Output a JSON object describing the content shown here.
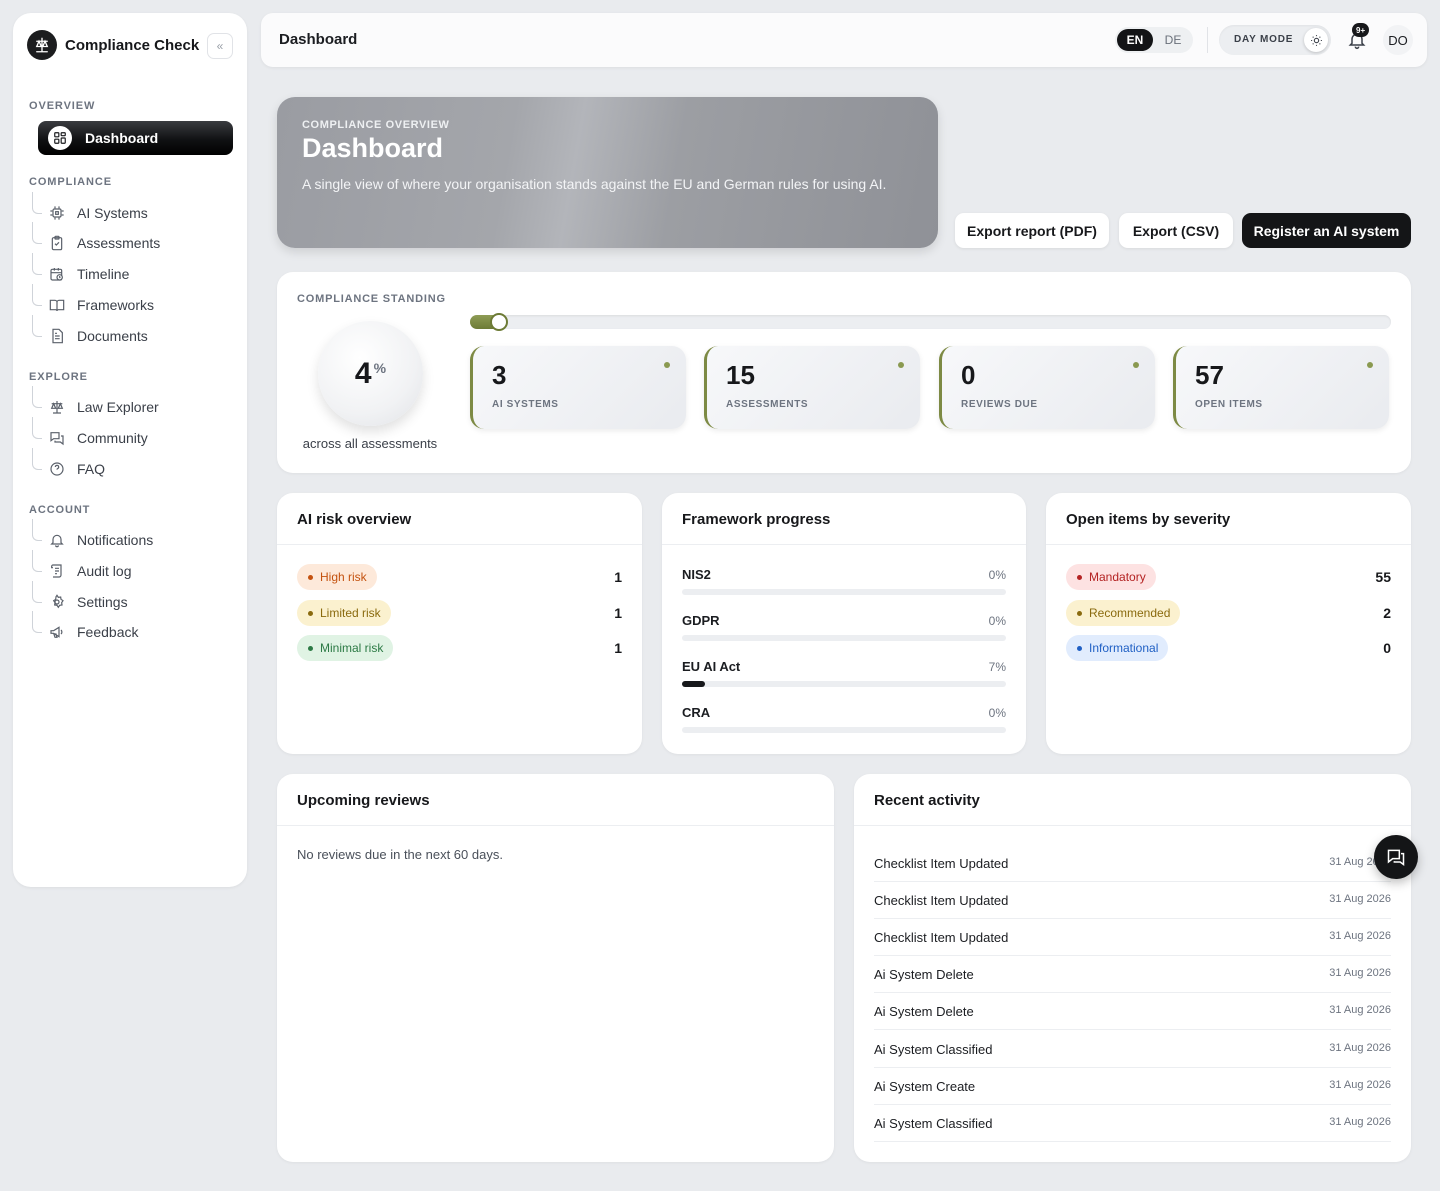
{
  "sidebar": {
    "brand": "Compliance Check",
    "collapse_icon": "«",
    "sections": {
      "overview": "OVERVIEW",
      "compliance": "COMPLIANCE",
      "explore": "EXPLORE",
      "account": "ACCOUNT"
    },
    "items": {
      "dashboard": "Dashboard",
      "ai_systems": "AI Systems",
      "assessments": "Assessments",
      "timeline": "Timeline",
      "frameworks": "Frameworks",
      "documents": "Documents",
      "law_explorer": "Law Explorer",
      "community": "Community",
      "faq": "FAQ",
      "notifications": "Notifications",
      "audit_log": "Audit log",
      "settings": "Settings",
      "feedback": "Feedback"
    }
  },
  "topbar": {
    "title": "Dashboard",
    "lang_en": "EN",
    "lang_de": "DE",
    "day_mode": "DAY MODE",
    "notif_badge": "9+",
    "avatar": "DO"
  },
  "hero": {
    "kicker": "COMPLIANCE OVERVIEW",
    "title": "Dashboard",
    "description": "A single view of where your organisation stands against the EU and German rules for using AI."
  },
  "actions": {
    "export_pdf": "Export report (PDF)",
    "export_csv": "Export (CSV)",
    "register": "Register an AI system"
  },
  "standing": {
    "label": "COMPLIANCE STANDING",
    "value": "4",
    "unit": "%",
    "progress": 0.04,
    "caption": "across all assessments",
    "stats": [
      {
        "value": "3",
        "label": "AI SYSTEMS"
      },
      {
        "value": "15",
        "label": "ASSESSMENTS"
      },
      {
        "value": "0",
        "label": "REVIEWS DUE"
      },
      {
        "value": "57",
        "label": "OPEN ITEMS"
      }
    ]
  },
  "risk": {
    "title": "AI risk overview",
    "rows": [
      {
        "label": "High risk",
        "count": "1",
        "color": "#c4520f",
        "bg": "#fde9da"
      },
      {
        "label": "Limited risk",
        "count": "1",
        "color": "#8a6a0e",
        "bg": "#fbf1cf"
      },
      {
        "label": "Minimal risk",
        "count": "1",
        "color": "#2c7a45",
        "bg": "#e0f3e4"
      }
    ]
  },
  "frameworks": {
    "title": "Framework progress",
    "rows": [
      {
        "name": "NIS2",
        "pct_label": "0%",
        "value": 0
      },
      {
        "name": "GDPR",
        "pct_label": "0%",
        "value": 0
      },
      {
        "name": "EU AI Act",
        "pct_label": "7%",
        "value": 0.07
      },
      {
        "name": "CRA",
        "pct_label": "0%",
        "value": 0
      }
    ]
  },
  "severity": {
    "title": "Open items by severity",
    "rows": [
      {
        "label": "Mandatory",
        "count": "55",
        "color": "#b42323",
        "bg": "#fde2e2"
      },
      {
        "label": "Recommended",
        "count": "2",
        "color": "#8a6a0e",
        "bg": "#fbf1cf"
      },
      {
        "label": "Informational",
        "count": "0",
        "color": "#1f5fc4",
        "bg": "#e1ecfd"
      }
    ]
  },
  "reviews": {
    "title": "Upcoming reviews",
    "empty": "No reviews due in the next 60 days."
  },
  "activity": {
    "title": "Recent activity",
    "rows": [
      {
        "name": "Checklist Item Updated",
        "date": "31 Aug 2026"
      },
      {
        "name": "Checklist Item Updated",
        "date": "31 Aug 2026"
      },
      {
        "name": "Checklist Item Updated",
        "date": "31 Aug 2026"
      },
      {
        "name": "Ai System Delete",
        "date": "31 Aug 2026"
      },
      {
        "name": "Ai System Delete",
        "date": "31 Aug 2026"
      },
      {
        "name": "Ai System Classified",
        "date": "31 Aug 2026"
      },
      {
        "name": "Ai System Create",
        "date": "31 Aug 2026"
      },
      {
        "name": "Ai System Classified",
        "date": "31 Aug 2026"
      }
    ]
  }
}
